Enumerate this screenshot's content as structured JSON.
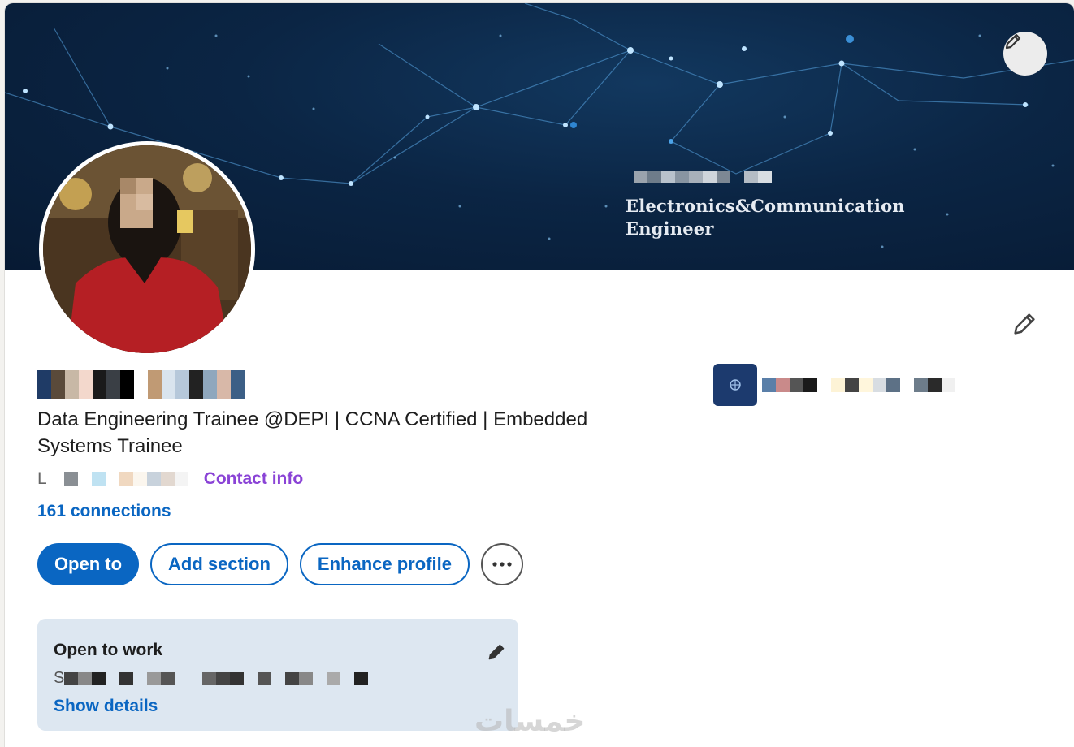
{
  "banner": {
    "subtitle_line1": "Electronics&Communication",
    "subtitle_line2": "Engineer",
    "edit_icon": "pencil-icon"
  },
  "profile": {
    "headline": "Data Engineering Trainee @DEPI | CCNA Certified | Embedded Systems Trainee",
    "location_prefix": "L",
    "contact_info": "Contact info",
    "connections": "161 connections"
  },
  "actions": {
    "open_to": "Open to",
    "add_section": "Add section",
    "enhance_profile": "Enhance profile",
    "more_icon": "ellipsis-icon"
  },
  "open_to_work": {
    "title": "Open to work",
    "detail_prefix": "S",
    "show_details": "Show details"
  },
  "watermark": "خمسات",
  "colors": {
    "accent": "#0a66c2",
    "contact_link": "#8a43d6",
    "banner": "#0b2544",
    "open_to_work_bg": "#dde7f1"
  }
}
